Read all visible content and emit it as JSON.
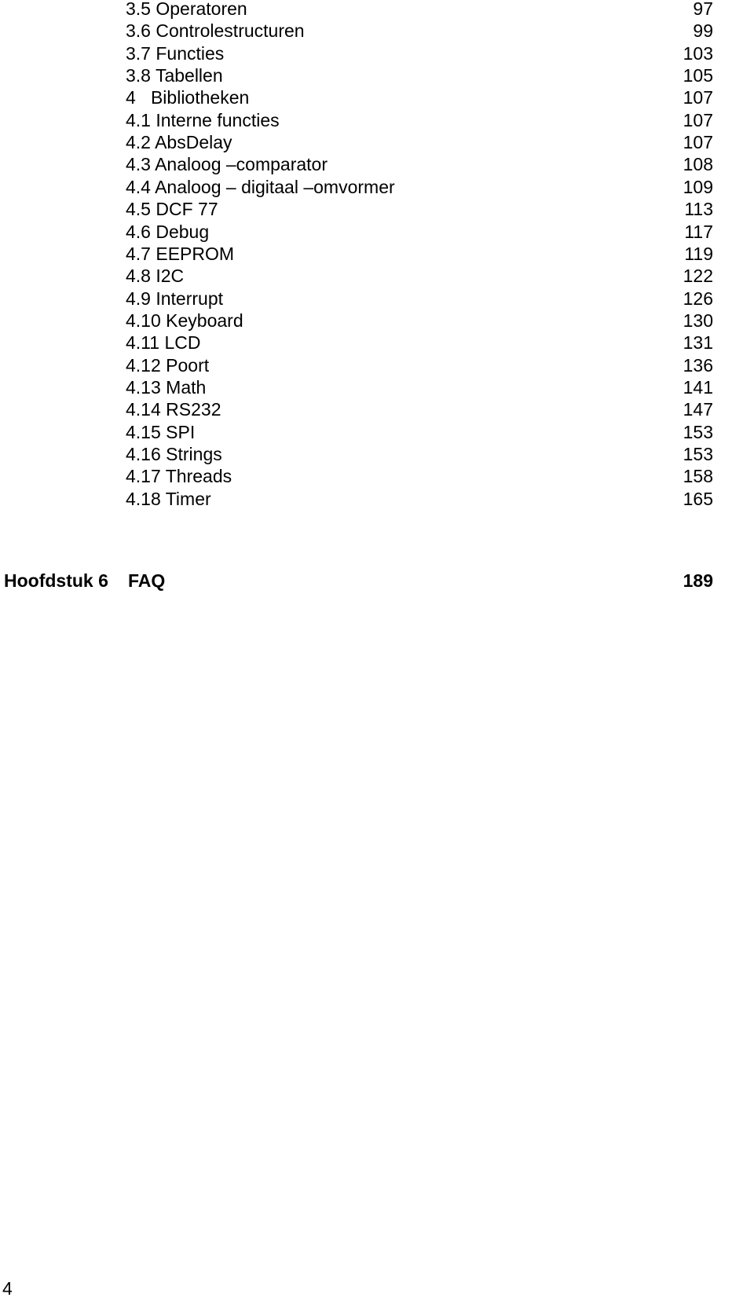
{
  "toc": {
    "entries": [
      {
        "title": "3.5 Operatoren",
        "page": "97"
      },
      {
        "title": "3.6 Controlestructuren",
        "page": "99"
      },
      {
        "title": "3.7 Functies",
        "page": "103"
      },
      {
        "title": "3.8 Tabellen",
        "page": "105"
      },
      {
        "title": "4   Bibliotheken",
        "page": "107"
      },
      {
        "title": "4.1 Interne functies",
        "page": "107"
      },
      {
        "title": "4.2 AbsDelay",
        "page": "107"
      },
      {
        "title": "4.3 Analoog –comparator",
        "page": "108"
      },
      {
        "title": "4.4 Analoog – digitaal –omvormer",
        "page": "109"
      },
      {
        "title": "4.5 DCF 77",
        "page": "113"
      },
      {
        "title": "4.6 Debug",
        "page": "117"
      },
      {
        "title": "4.7 EEPROM",
        "page": "119"
      },
      {
        "title": "4.8 I2C",
        "page": "122"
      },
      {
        "title": "4.9 Interrupt",
        "page": "126"
      },
      {
        "title": "4.10 Keyboard",
        "page": "130"
      },
      {
        "title": "4.11 LCD",
        "page": "131"
      },
      {
        "title": "4.12 Poort",
        "page": "136"
      },
      {
        "title": "4.13 Math",
        "page": "141"
      },
      {
        "title": "4.14 RS232",
        "page": "147"
      },
      {
        "title": "4.15 SPI",
        "page": "153"
      },
      {
        "title": "4.16 Strings",
        "page": "153"
      },
      {
        "title": "4.17 Threads",
        "page": "158"
      },
      {
        "title": "4.18 Timer",
        "page": "165"
      }
    ],
    "chapter": {
      "label": "Hoofdstuk 6",
      "name": "FAQ",
      "page": "189"
    }
  },
  "footer": {
    "page_number": "4"
  }
}
